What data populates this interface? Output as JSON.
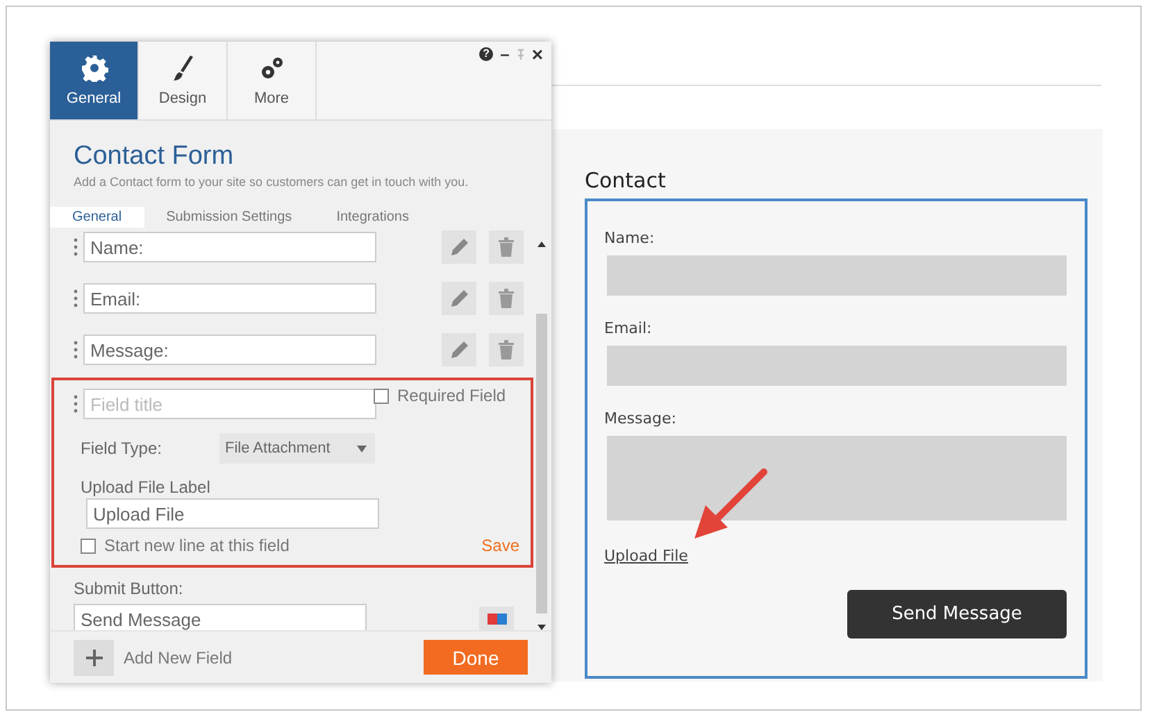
{
  "editor": {
    "window_controls": [
      "?",
      "–",
      "×"
    ],
    "tabs": [
      {
        "label": "General",
        "selected": true
      },
      {
        "label": "Design",
        "selected": false
      },
      {
        "label": "More",
        "selected": false
      }
    ],
    "title": "Contact Form",
    "subtitle": "Add a Contact form to your site so customers can get in touch with you.",
    "subtabs": [
      {
        "label": "General",
        "selected": true
      },
      {
        "label": "Submission Settings",
        "selected": false
      },
      {
        "label": "Integrations",
        "selected": false
      }
    ],
    "fields": [
      {
        "value": "Name:"
      },
      {
        "value": "Email:"
      },
      {
        "value": "Message:"
      }
    ],
    "edit_field": {
      "placeholder": "Field title",
      "required": {
        "label": "Required Field",
        "checked": false
      },
      "type_label": "Field Type:",
      "type_value": "File Attachment",
      "upload_label": "Upload File Label",
      "upload_value": "Upload File",
      "new_line": {
        "label": "Start new line at this field",
        "checked": false
      },
      "save": "Save"
    },
    "submit": {
      "label": "Submit Button:",
      "value": "Send Message"
    },
    "add_field": "Add New Field",
    "done": "Done"
  },
  "preview": {
    "title": "Contact",
    "fields": [
      {
        "label": "Name:",
        "kind": "input"
      },
      {
        "label": "Email:",
        "kind": "input"
      },
      {
        "label": "Message:",
        "kind": "textarea"
      }
    ],
    "upload_link": "Upload File",
    "submit": "Send Message"
  }
}
